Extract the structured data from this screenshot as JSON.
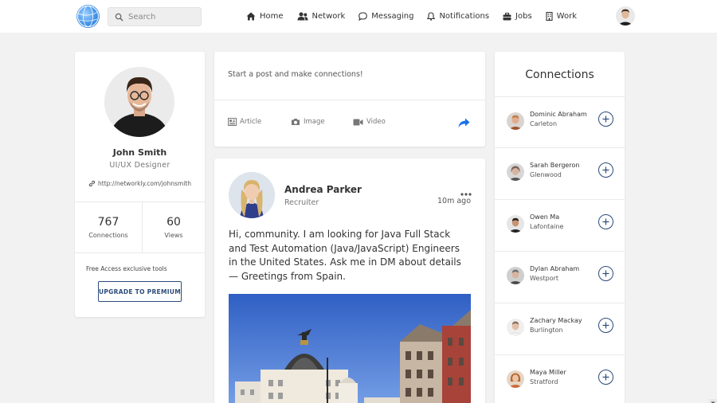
{
  "header": {
    "logo_icon": "globe-logo-icon",
    "search": {
      "placeholder": "Search",
      "icon": "search-icon"
    },
    "nav": [
      {
        "label": "Home",
        "icon": "home-icon"
      },
      {
        "label": "Network",
        "icon": "users-icon"
      },
      {
        "label": "Messaging",
        "icon": "chat-icon"
      },
      {
        "label": "Notifications",
        "icon": "bell-icon"
      },
      {
        "label": "Jobs",
        "icon": "briefcase-icon"
      },
      {
        "label": "Work",
        "icon": "building-icon"
      }
    ],
    "avatar_icon": "user-avatar"
  },
  "profile": {
    "name": "John Smith",
    "title": "UI/UX Designer",
    "link": "http://networkly.com/johnsmith",
    "stats": [
      {
        "value": "767",
        "label": "Connections"
      },
      {
        "value": "60",
        "label": "Views"
      }
    ],
    "premium_text": "Free Access exclusive tools",
    "premium_button": "UPGRADE TO PREMIUM"
  },
  "composer": {
    "placeholder": "Start a post and make connections!",
    "options": [
      {
        "label": "Article",
        "icon": "article-icon"
      },
      {
        "label": "Image",
        "icon": "camera-icon"
      },
      {
        "label": "Video",
        "icon": "video-icon"
      }
    ],
    "share_icon": "share-arrow-icon"
  },
  "post": {
    "author": "Andrea Parker",
    "role": "Recruiter",
    "time": "10m ago",
    "text": "Hi, community. I am looking for Java Full Stack and Test Automation (Java/JavaScript) Engineers in the United States. Ask me in DM about details — Greetings from Spain."
  },
  "connections": {
    "title": "Connections",
    "items": [
      {
        "name": "Dominic Abraham",
        "city": "Carleton"
      },
      {
        "name": "Sarah Bergeron",
        "city": "Glenwood"
      },
      {
        "name": "Owen Ma",
        "city": "Lafontaine"
      },
      {
        "name": "Dylan Abraham",
        "city": "Westport"
      },
      {
        "name": "Zachary Mackay",
        "city": "Burlington"
      },
      {
        "name": "Maya Miller",
        "city": "Stratford"
      }
    ]
  },
  "colors": {
    "accent": "#2c4c7a",
    "link_blue": "#1a73e8",
    "background": "#f2f2f2"
  }
}
